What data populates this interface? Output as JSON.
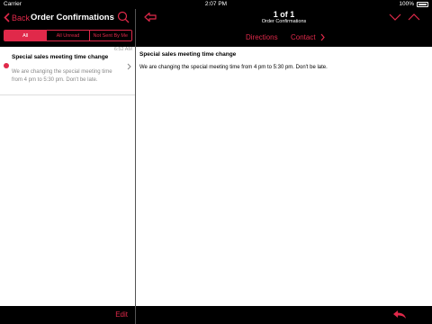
{
  "status_bar": {
    "carrier": "Carrier",
    "time": "2:07 PM",
    "battery": "100%"
  },
  "sidebar": {
    "back_label": "Back",
    "title": "Order Confirmations",
    "filters": [
      {
        "label": "All",
        "selected": true
      },
      {
        "label": "All Unread",
        "selected": false
      },
      {
        "label": "Not Sent By Me",
        "selected": false
      }
    ],
    "messages": [
      {
        "time": "6:52 AM",
        "subject": "Special sales meeting time change",
        "preview": "We are changing the special meeting time from 4 pm to 5:30 pm.  Don't be late.",
        "unread": true
      }
    ],
    "edit_label": "Edit"
  },
  "detail": {
    "counter": "1 of 1",
    "folder": "Order Confirmations",
    "tabs": {
      "directions": "Directions",
      "contact": "Contact"
    },
    "subject": "Special sales meeting time change",
    "body": "We are changing the special meeting time from 4 pm to 5:30 pm.  Don't be late."
  },
  "colors": {
    "accent": "#e0294a",
    "bar": "#000000",
    "content": "#ffffff"
  }
}
